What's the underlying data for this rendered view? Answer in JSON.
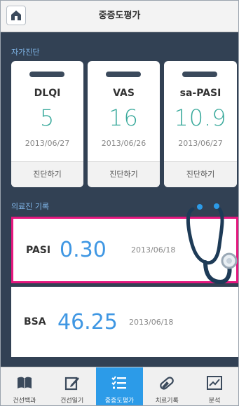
{
  "header": {
    "title": "중증도평가"
  },
  "self_diagnosis": {
    "label": "자가진단",
    "cards": [
      {
        "name": "DLQI",
        "value": "5",
        "date": "2013/06/27",
        "action": "진단하기"
      },
      {
        "name": "VAS",
        "value": "16",
        "date": "2013/06/26",
        "action": "진단하기"
      },
      {
        "name": "sa-PASI",
        "value": "10.9",
        "date": "2013/06/27",
        "action": "진단하기"
      }
    ]
  },
  "medical_records": {
    "label": "의료진 기록",
    "items": [
      {
        "name": "PASI",
        "value": "0.30",
        "date": "2013/06/18"
      },
      {
        "name": "BSA",
        "value": "46.25",
        "date": "2013/06/18"
      }
    ]
  },
  "nav": {
    "items": [
      {
        "label": "건선백과",
        "icon": "book-icon"
      },
      {
        "label": "건선일기",
        "icon": "edit-icon"
      },
      {
        "label": "중증도평가",
        "icon": "checklist-icon",
        "active": true
      },
      {
        "label": "치료기록",
        "icon": "pill-icon"
      },
      {
        "label": "분석",
        "icon": "chart-icon"
      }
    ]
  },
  "colors": {
    "background": "#324154",
    "value_green": "#38a99b",
    "value_blue": "#3f97e3",
    "highlight": "#e5177e",
    "nav_active": "#2c9be8"
  }
}
